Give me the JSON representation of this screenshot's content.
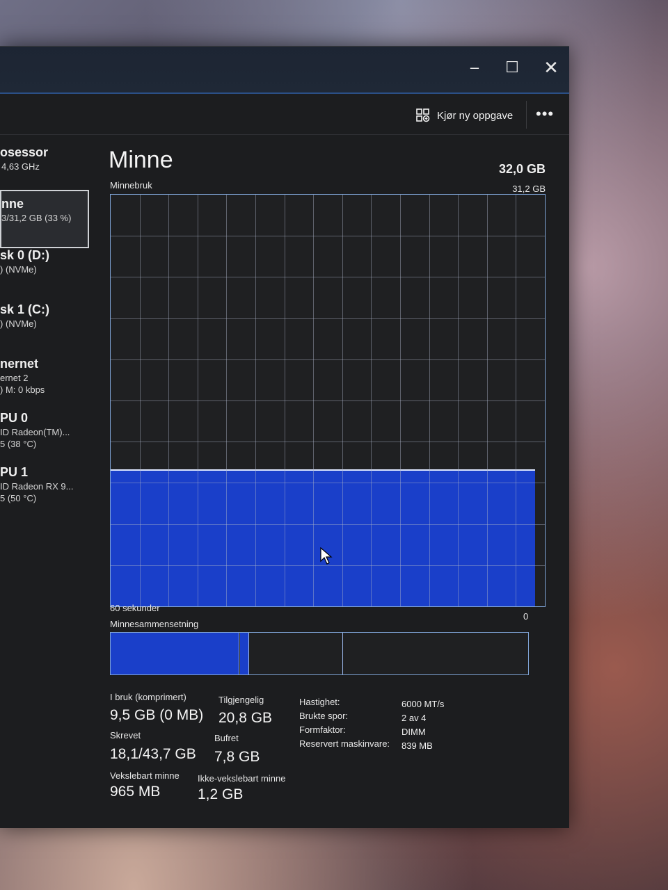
{
  "window": {
    "buttons": {
      "minimize": "–",
      "maximize": "☐",
      "close": "✕"
    }
  },
  "toolbar": {
    "new_task": "Kjør ny oppgave",
    "more": "•••"
  },
  "sidebar": {
    "items": [
      {
        "title": "osessor",
        "sub": "4,63 GHz"
      },
      {
        "title": "nne",
        "sub": "3/31,2 GB (33 %)"
      },
      {
        "title": "sk 0 (D:)",
        "sub": ") (NVMe)"
      },
      {
        "title": "sk 1 (C:)",
        "sub": ") (NVMe)"
      },
      {
        "title": "nernet",
        "sub": "ernet 2",
        "sub2": ") M: 0 kbps"
      },
      {
        "title": "PU 0",
        "sub": "ID Radeon(TM)...",
        "sub2": "5 (38 °C)"
      },
      {
        "title": "PU 1",
        "sub": "ID Radeon RX 9...",
        "sub2": "5 (50 °C)"
      }
    ]
  },
  "main": {
    "title": "Minne",
    "total": "32,0 GB",
    "usage_label": "Minnebruk",
    "usage_max": "31,2 GB",
    "time_label": "60 sekunder",
    "zero": "0",
    "composition_label": "Minnesammensetning",
    "usage_fraction": 0.33,
    "stats": {
      "in_use_label": "I bruk (komprimert)",
      "in_use": "9,5 GB (0 MB)",
      "available_label": "Tilgjengelig",
      "available": "20,8 GB",
      "committed_label": "Skrevet",
      "committed": "18,1/43,7 GB",
      "cached_label": "Bufret",
      "cached": "7,8 GB",
      "paged_label": "Vekslebart minne",
      "paged": "965 MB",
      "nonpaged_label": "Ikke-vekslebart minne",
      "nonpaged": "1,2 GB"
    },
    "details": {
      "speed_label": "Hastighet:",
      "speed": "6000 MT/s",
      "slots_label": "Brukte spor:",
      "slots": "2 av 4",
      "form_label": "Formfaktor:",
      "form": "DIMM",
      "reserved_label": "Reservert maskinvare:",
      "reserved": "839 MB"
    }
  },
  "colors": {
    "accent": "#1a3fc9",
    "border": "#7fa4d6"
  }
}
